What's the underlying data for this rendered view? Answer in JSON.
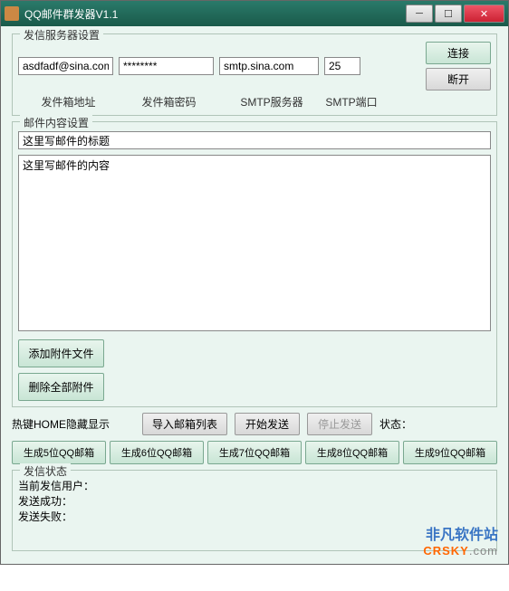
{
  "window": {
    "title": "QQ邮件群发器V1.1"
  },
  "server": {
    "group_title": "发信服务器设置",
    "address_value": "asdfadf@sina.com",
    "address_label": "发件箱地址",
    "password_value": "********",
    "password_label": "发件箱密码",
    "smtp_value": "smtp.sina.com",
    "smtp_label": "SMTP服务器",
    "port_value": "25",
    "port_label": "SMTP端口",
    "connect_label": "连接",
    "disconnect_label": "断开"
  },
  "mail": {
    "group_title": "邮件内容设置",
    "subject_placeholder": "这里写邮件的标题",
    "body_placeholder": "这里写邮件的内容",
    "add_attach_label": "添加附件文件",
    "del_attach_label": "删除全部附件"
  },
  "actions": {
    "hotkey_label": "热键HOME隐藏显示",
    "import_label": "导入邮箱列表",
    "start_label": "开始发送",
    "stop_label": "停止发送",
    "status_prefix": "状态："
  },
  "gen": {
    "g5": "生成5位QQ邮箱",
    "g6": "生成6位QQ邮箱",
    "g7": "生成7位QQ邮箱",
    "g8": "生成8位QQ邮箱",
    "g9": "生成9位QQ邮箱"
  },
  "status": {
    "group_title": "发信状态",
    "current_user": "当前发信用户：",
    "success": "发送成功：",
    "fail": "发送失败："
  },
  "watermark": {
    "cn": "非凡软件站",
    "en_prefix": "CRSKY",
    "en_suffix": ".com"
  }
}
